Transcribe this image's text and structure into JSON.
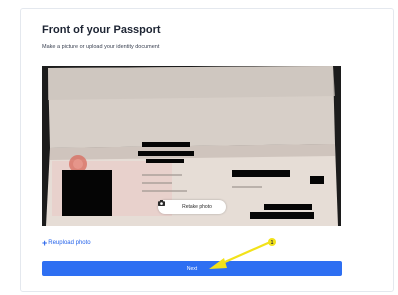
{
  "page": {
    "title": "Front of your Passport",
    "subtitle": "Make a picture or upload your identity document"
  },
  "photo": {
    "retake_label": "Retake photo",
    "retake_icon": "camera-icon"
  },
  "actions": {
    "reupload_icon": "plus-icon",
    "reupload_label": "Reupload photo",
    "next_label": "Next"
  },
  "annotation": {
    "badge": "1",
    "color": "#f2e21a"
  },
  "colors": {
    "accent": "#2e6ff2",
    "link": "#2563eb"
  }
}
